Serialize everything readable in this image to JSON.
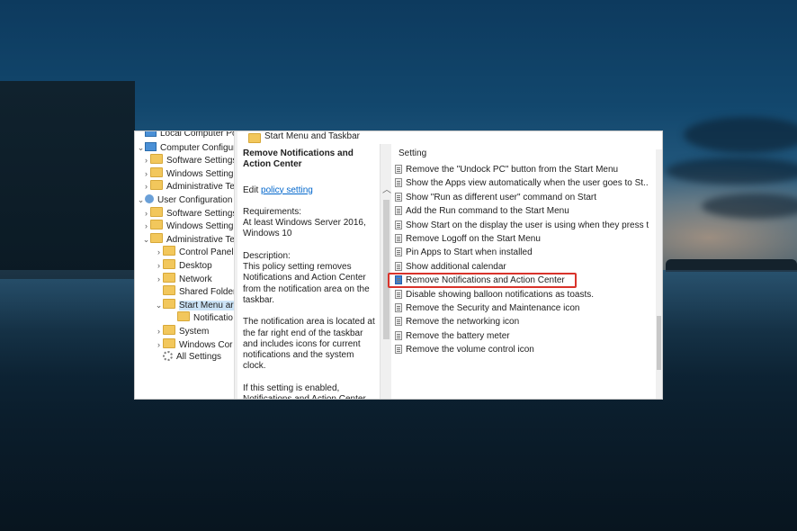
{
  "tree": {
    "items": [
      {
        "label": "Local Computer Policy",
        "icon": "pc-icon",
        "chev": "",
        "indent": 2
      },
      {
        "label": "Computer Configura",
        "icon": "pc-icon",
        "chev": "⌄",
        "indent": 2
      },
      {
        "label": "Software Settings",
        "icon": "folder-icon",
        "chev": "›",
        "indent": 8
      },
      {
        "label": "Windows Setting",
        "icon": "folder-icon",
        "chev": "›",
        "indent": 8
      },
      {
        "label": "Administrative Te",
        "icon": "folder-icon",
        "chev": "›",
        "indent": 8
      },
      {
        "label": "User Configuration",
        "icon": "user-icon",
        "chev": "⌄",
        "indent": 2
      },
      {
        "label": "Software Settings",
        "icon": "folder-icon",
        "chev": "›",
        "indent": 8
      },
      {
        "label": "Windows Setting",
        "icon": "folder-icon",
        "chev": "›",
        "indent": 8
      },
      {
        "label": "Administrative Te",
        "icon": "folder-icon",
        "chev": "⌄",
        "indent": 8
      },
      {
        "label": "Control Panel",
        "icon": "folder-icon",
        "chev": "›",
        "indent": 22
      },
      {
        "label": "Desktop",
        "icon": "folder-icon",
        "chev": "›",
        "indent": 22
      },
      {
        "label": "Network",
        "icon": "folder-icon",
        "chev": "›",
        "indent": 22
      },
      {
        "label": "Shared Folder",
        "icon": "folder-icon",
        "chev": "",
        "indent": 22
      },
      {
        "label": "Start Menu ar",
        "icon": "folder-icon",
        "chev": "⌄",
        "indent": 22,
        "selected": true
      },
      {
        "label": "Notificatio",
        "icon": "folder-icon",
        "chev": "",
        "indent": 38
      },
      {
        "label": "System",
        "icon": "folder-icon",
        "chev": "›",
        "indent": 22
      },
      {
        "label": "Windows Cor",
        "icon": "folder-icon",
        "chev": "›",
        "indent": 22
      },
      {
        "label": "All Settings",
        "icon": "gear-icon",
        "chev": "",
        "indent": 22
      }
    ]
  },
  "header": {
    "title": "Start Menu and Taskbar"
  },
  "description": {
    "title": "Remove Notifications and Action Center",
    "edit_prefix": "Edit ",
    "edit_link": "policy setting",
    "requirements_label": "Requirements:",
    "requirements_text": "At least Windows Server 2016, Windows 10",
    "description_label": "Description:",
    "description_text": "This policy setting removes Notifications and Action Center from the notification area on the taskbar.",
    "paragraph2": "The notification area is located at the far right end of the taskbar and includes icons for current notifications and the system clock.",
    "paragraph3": "If this setting is enabled, Notifications and Action Center"
  },
  "list": {
    "column_header": "Setting",
    "rows": [
      "Remove the \"Undock PC\" button from the Start Menu",
      "Show the Apps view automatically when the user goes to St...",
      "Show \"Run as different user\" command on Start",
      "Add the Run command to the Start Menu",
      "Show Start on the display the user is using when they press t...",
      "Remove Logoff on the Start Menu",
      "Pin Apps to Start when installed",
      "Show additional calendar",
      "Remove Notifications and Action Center",
      "Disable showing balloon notifications as toasts.",
      "Remove the Security and Maintenance icon",
      "Remove the networking icon",
      "Remove the battery meter",
      "Remove the volume control icon"
    ],
    "highlighted_index": 8
  },
  "colors": {
    "highlight_border": "#d9332b",
    "selection": "#cce4f7",
    "link": "#0066cc"
  }
}
